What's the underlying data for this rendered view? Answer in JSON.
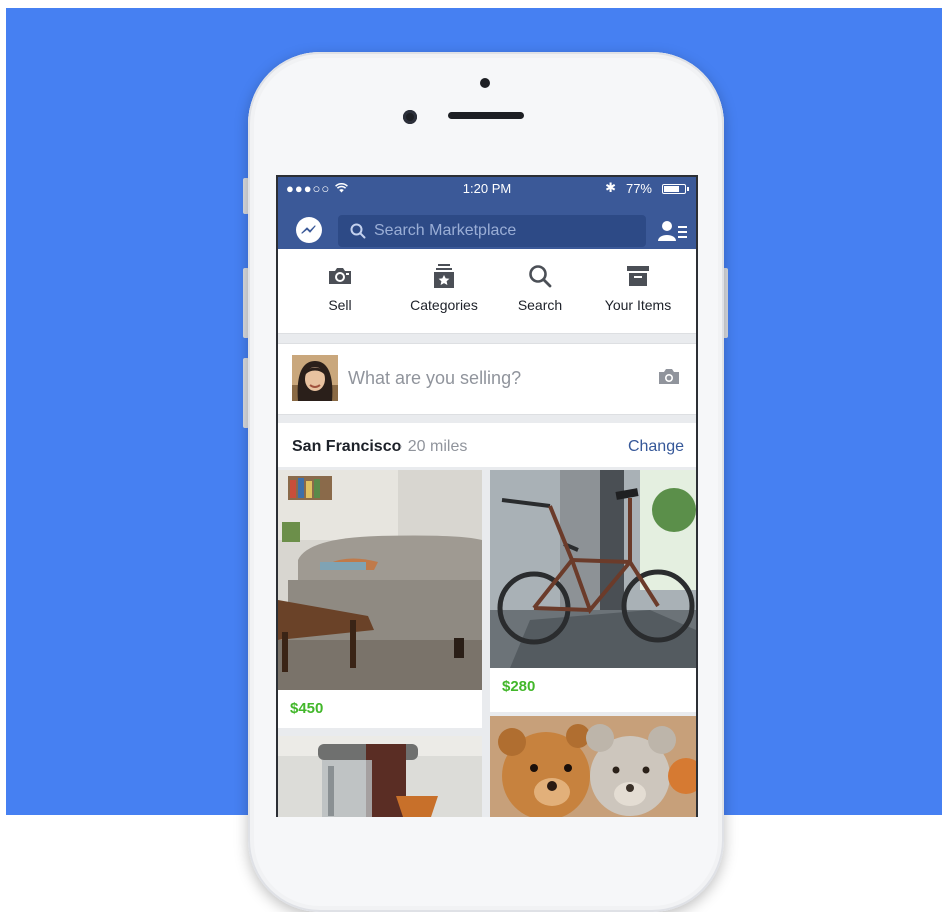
{
  "status_bar": {
    "carrier": "●●●○○ ",
    "wifi": "wifi-icon",
    "time": "1:20 PM",
    "bluetooth": "✱",
    "battery_percent": "77%",
    "battery_level": 0.77
  },
  "header": {
    "search_placeholder": "Search Marketplace"
  },
  "shortcuts": [
    {
      "label": "Sell",
      "icon": "camera-icon"
    },
    {
      "label": "Categories",
      "icon": "categories-icon"
    },
    {
      "label": "Search",
      "icon": "search-icon"
    },
    {
      "label": "Your Items",
      "icon": "your-items-icon"
    }
  ],
  "composer": {
    "placeholder": "What are you selling?"
  },
  "location": {
    "city": "San Francisco",
    "distance": "· 20 miles",
    "change_label": "Change"
  },
  "listings": [
    {
      "price": "$450",
      "image": "sofa"
    },
    {
      "price": "$280",
      "image": "bicycle"
    },
    {
      "price": "",
      "image": "coffee-maker"
    },
    {
      "price": "",
      "image": "teddy-bears"
    }
  ],
  "colors": {
    "background": "#4680f2",
    "facebook_blue": "#3b5998",
    "price_green": "#42b72a",
    "link_blue": "#365899"
  }
}
